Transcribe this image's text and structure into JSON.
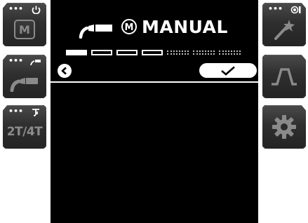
{
  "screen": {
    "mode_label": "MANUAL",
    "mode_badge": "M",
    "steps": [
      "filled",
      "outline",
      "outline",
      "outline",
      "dotted",
      "dotted",
      "dotted"
    ],
    "back_icon": "chevron-left-icon",
    "confirm_icon": "checkmark-icon"
  },
  "left_buttons": [
    {
      "id": "mode",
      "dots": "•••",
      "top_icon": "power-icon",
      "label": "M"
    },
    {
      "id": "torch",
      "dots": "•••",
      "top_icon": "torch-small-icon",
      "icon": "torch-icon"
    },
    {
      "id": "trigger",
      "dots": "•••",
      "top_icon": "trigger-icon",
      "label": "2T/4T"
    }
  ],
  "right_buttons": [
    {
      "id": "program",
      "dots": "•••",
      "top_icon": "record-icon",
      "icon": "magic-wand-icon"
    },
    {
      "id": "waveform",
      "icon": "waveform-icon"
    },
    {
      "id": "settings",
      "icon": "gear-icon"
    }
  ],
  "colors": {
    "screen_bg": "#000000",
    "screen_fg": "#ffffff",
    "button_bg": "#2f2f2f",
    "button_icon": "#8a8a8a"
  }
}
